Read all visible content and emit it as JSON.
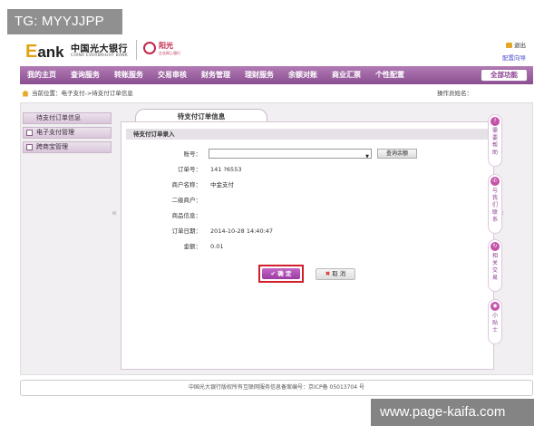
{
  "watermark_top": "TG: MYYJJPP",
  "watermark_bottom": "www.page-kaifa.com",
  "header": {
    "logo_e": "E",
    "logo_ank": "ank",
    "bank_name_cn": "中国光大银行",
    "bank_name_en": "CHINA EVERBRIGHT BANK",
    "service_name": "阳光",
    "service_sub": "企业网上银行",
    "exit_label": "退出",
    "config_label": "配置向导"
  },
  "nav": {
    "items": [
      "我的主页",
      "查询服务",
      "转账服务",
      "交易审核",
      "财务管理",
      "理财服务",
      "余额对账",
      "商业汇票",
      "个性配置"
    ],
    "all_label": "全部功能"
  },
  "breadcrumb": {
    "text": "当前位置：电子支付->待支付订单信息",
    "operator_label": "操作员姓名："
  },
  "sidebar": {
    "items": [
      "待支付订单信息",
      "电子支付管理",
      "跨商宝管理"
    ]
  },
  "tab": {
    "title": "待支付订单信息"
  },
  "form": {
    "section_title": "待支付订单录入",
    "account_label": "账号：",
    "account_value": "",
    "query_balance": "查询余额",
    "order_no_label": "订单号：",
    "order_no_value": "141        ?6553",
    "merchant_name_label": "商户名称：",
    "merchant_name_value": "中金支付",
    "secondary_merchant_label": "二级商户：",
    "secondary_merchant_value": "",
    "product_info_label": "商品信息：",
    "product_info_value": "",
    "order_date_label": "订单日期：",
    "order_date_value": "2014-10-28 14:40:47",
    "amount_label": "金额：",
    "amount_value": "0.01",
    "confirm_label": "确 定",
    "cancel_label": "取 消"
  },
  "right_widgets": [
    {
      "label": "需要帮助",
      "icon": "?"
    },
    {
      "label": "与我们联系",
      "icon": "✆"
    },
    {
      "label": "相关交易",
      "icon": "↻"
    },
    {
      "label": "小贴士",
      "icon": "◉"
    }
  ],
  "footer": {
    "text": "中国光大银行版权所有互联网服务信息备案编号：京ICP备 05013704 号"
  },
  "colors": {
    "nav_purple": "#8a4e90",
    "accent_red": "#d21f2b",
    "brand_magenta": "#c3264a"
  }
}
